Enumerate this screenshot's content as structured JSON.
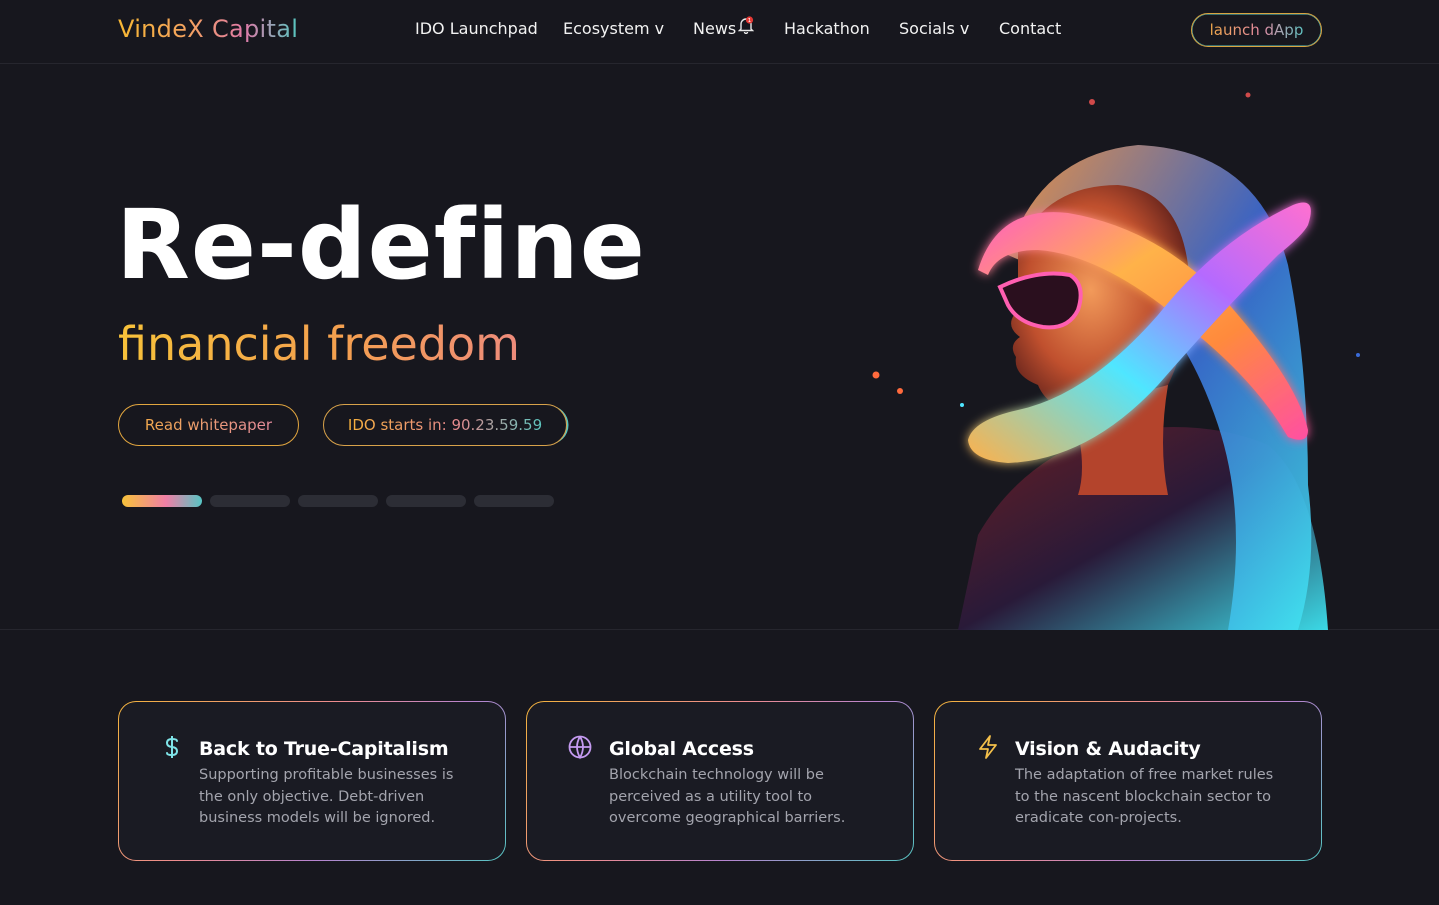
{
  "header": {
    "logo": "VindeX Capital",
    "nav": [
      {
        "label": "IDO Launchpad"
      },
      {
        "label": "Ecosystem v"
      },
      {
        "label": "News"
      },
      {
        "label": "Hackathon"
      },
      {
        "label": "Socials v"
      },
      {
        "label": "Contact"
      }
    ],
    "news_badge": "1",
    "launch_label": "launch dApp"
  },
  "hero": {
    "title": "Re-define",
    "subtitle": "financial freedom",
    "whitepaper_label": "Read whitepaper",
    "ido_label": "IDO starts in: 90.23.59.59",
    "slides_total": 5,
    "active_slide": 1
  },
  "features": [
    {
      "icon": "dollar-icon",
      "title": "Back to True-Capitalism",
      "text": "Supporting profitable businesses is the only objective. Debt-driven business models will be ignored."
    },
    {
      "icon": "globe-icon",
      "title": "Global Access",
      "text": "Blockchain technology will be perceived as a utility tool to overcome geographical barriers."
    },
    {
      "icon": "lightning-icon",
      "title": "Vision & Audacity",
      "text": "The adaptation of free market rules to the nascent blockchain sector to eradicate con-projects."
    }
  ],
  "colors": {
    "background": "#17171e",
    "accent_gold": "#f7c23a",
    "accent_pink": "#ef7fa6",
    "accent_teal": "#56c5c4"
  }
}
